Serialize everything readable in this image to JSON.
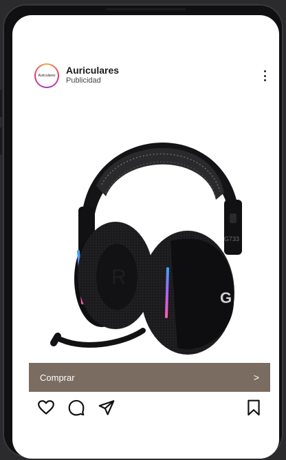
{
  "post": {
    "account_name": "Auriculares",
    "account_subtitle": "Publicidad",
    "avatar_text": "Auriculares"
  },
  "product": {
    "brand_text": "G733"
  },
  "cta": {
    "label": "Comprar",
    "chevron": ">"
  },
  "icons": {
    "more": "more-vertical-icon",
    "like": "heart-icon",
    "comment": "comment-icon",
    "share": "send-icon",
    "save": "bookmark-icon"
  },
  "colors": {
    "cta_background": "#7a6c61",
    "screen_background": "#ffffff",
    "device_frame": "#101012"
  }
}
